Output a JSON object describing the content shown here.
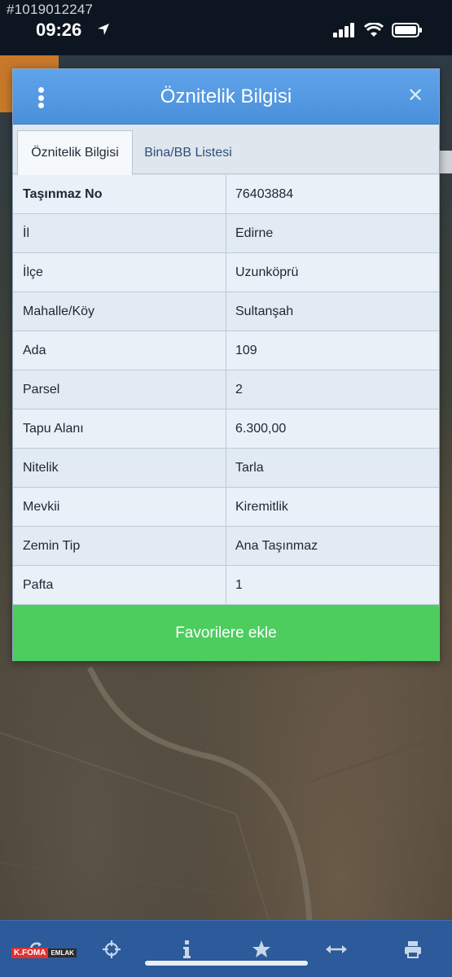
{
  "status_bar": {
    "watermark_id": "#1019012247",
    "time": "09:26"
  },
  "dialog": {
    "title": "Öznitelik Bilgisi",
    "menu_icon": "kebab-menu-icon",
    "close_icon": "close-icon",
    "tabs": [
      {
        "label": "Öznitelik Bilgisi",
        "active": true
      },
      {
        "label": "Bina/BB Listesi",
        "active": false
      }
    ],
    "rows": [
      {
        "key": "Taşınmaz No",
        "value": "76403884"
      },
      {
        "key": "İl",
        "value": "Edirne"
      },
      {
        "key": "İlçe",
        "value": "Uzunköprü"
      },
      {
        "key": "Mahalle/Köy",
        "value": "Sultanşah"
      },
      {
        "key": "Ada",
        "value": "109"
      },
      {
        "key": "Parsel",
        "value": "2"
      },
      {
        "key": "Tapu Alanı",
        "value": "6.300,00"
      },
      {
        "key": "Nitelik",
        "value": "Tarla"
      },
      {
        "key": "Mevkii",
        "value": "Kiremitlik"
      },
      {
        "key": "Zemin Tip",
        "value": "Ana Taşınmaz"
      },
      {
        "key": "Pafta",
        "value": "1"
      }
    ],
    "favorite_button": "Favorilere ekle"
  },
  "toolbar": {
    "items": [
      "refresh-icon",
      "crosshair-icon",
      "info-icon",
      "star-icon",
      "measure-arrows-icon",
      "print-icon"
    ],
    "brand_left": "K.FOMA",
    "brand_right": "EMLAK"
  },
  "colors": {
    "header_blue": "#4a8fda",
    "button_green": "#4ccd5e",
    "toolbar_blue": "#2c5a9a"
  }
}
